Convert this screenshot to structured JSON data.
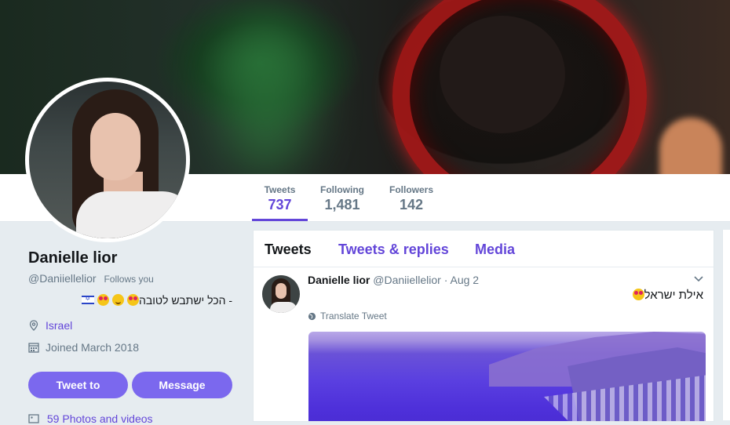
{
  "profile": {
    "name": "Danielle lior",
    "handle": "@Daniiellelior",
    "follows_you": "Follows you",
    "bio_text": "הכל ישתבש לטובה",
    "bio_dash": "-",
    "location": "Israel",
    "joined": "Joined March 2018",
    "photos": "59 Photos and videos"
  },
  "stats": [
    {
      "label": "Tweets",
      "value": "737"
    },
    {
      "label": "Following",
      "value": "1,481"
    },
    {
      "label": "Followers",
      "value": "142"
    }
  ],
  "buttons": {
    "tweet_to": "Tweet to",
    "message": "Message"
  },
  "tabs": {
    "tweets": "Tweets",
    "replies": "Tweets & replies",
    "media": "Media"
  },
  "tweet": {
    "name": "Danielle lior",
    "handle": "@Daniiellelior",
    "date": "· Aug 2",
    "text": "אילת ישראל",
    "translate": "Translate Tweet"
  },
  "colors": {
    "accent": "#6346d9",
    "button": "#7b68ee",
    "background": "#e6ecf0"
  }
}
